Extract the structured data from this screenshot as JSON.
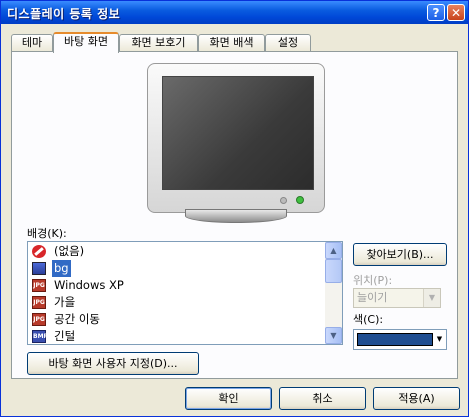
{
  "window": {
    "title": "디스플레이 등록 정보",
    "help_glyph": "?",
    "close_glyph": "✕"
  },
  "tabs": [
    {
      "label": "테마"
    },
    {
      "label": "바탕 화면"
    },
    {
      "label": "화면 보호기"
    },
    {
      "label": "화면 배색"
    },
    {
      "label": "설정"
    }
  ],
  "active_tab": "바탕 화면",
  "background": {
    "label": "배경(K):",
    "items": [
      {
        "label": "(없음)",
        "icon": "none-icon"
      },
      {
        "label": "bg",
        "icon": "bitmap-icon",
        "selected": true
      },
      {
        "label": "Windows XP",
        "icon": "jpg-icon"
      },
      {
        "label": "가을",
        "icon": "jpg-icon"
      },
      {
        "label": "공간 이동",
        "icon": "jpg-icon"
      },
      {
        "label": "긴털",
        "icon": "bmp-icon"
      }
    ]
  },
  "browse_button": "찾아보기(B)...",
  "position": {
    "label": "위치(P):",
    "value": "늘이기"
  },
  "color": {
    "label": "색(C):",
    "value": "#1f4e91"
  },
  "customize_button": "바탕 화면 사용자 지정(D)...",
  "footer": {
    "ok": "확인",
    "cancel": "취소",
    "apply": "적용(A)"
  },
  "icon_text": {
    "jpg": "JPG",
    "bmp": "BMP"
  }
}
